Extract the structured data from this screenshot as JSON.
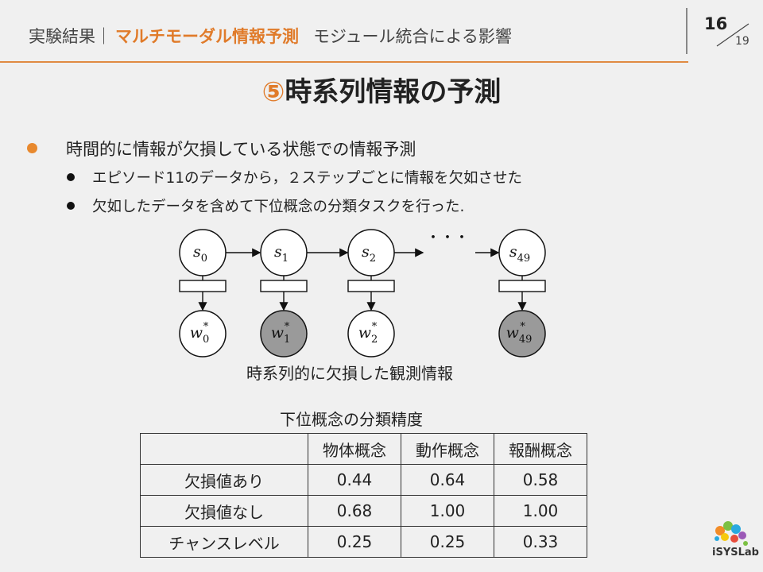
{
  "header": {
    "prefix": "実験結果｜",
    "accent": "マルチモーダル情報予測",
    "subtitle": "モジュール統合による影響",
    "page": "16",
    "total": "19"
  },
  "main_title": {
    "num": "⑤",
    "text": "時系列情報の予測"
  },
  "bullets": {
    "level1": "時間的に情報が欠損している状態での情報予測",
    "level2": [
      "エピソード11のデータから，２ステップごとに情報を欠如させた",
      "欠如したデータを含めて下位概念の分類タスクを行った."
    ]
  },
  "diagram": {
    "states": [
      {
        "base": "s",
        "sub": "0"
      },
      {
        "base": "s",
        "sub": "1"
      },
      {
        "base": "s",
        "sub": "2"
      },
      {
        "base": "s",
        "sub": "49"
      }
    ],
    "observations": [
      {
        "base": "w",
        "sub": "0",
        "sup": "*",
        "missing": false
      },
      {
        "base": "w",
        "sub": "1",
        "sup": "*",
        "missing": true
      },
      {
        "base": "w",
        "sub": "2",
        "sup": "*",
        "missing": false
      },
      {
        "base": "w",
        "sub": "49",
        "sup": "*",
        "missing": true
      }
    ],
    "ellipsis": "・・・",
    "caption": "時系列的に欠損した観測情報",
    "colors": {
      "missing_fill": "#9a9a9a",
      "normal_fill": "#ffffff"
    }
  },
  "table": {
    "title": "下位概念の分類精度",
    "columns": [
      "",
      "物体概念",
      "動作概念",
      "報酬概念"
    ],
    "rows": [
      {
        "label": "欠損値あり",
        "values": [
          "0.44",
          "0.64",
          "0.58"
        ]
      },
      {
        "label": "欠損値なし",
        "values": [
          "0.68",
          "1.00",
          "1.00"
        ]
      },
      {
        "label": "チャンスレベル",
        "values": [
          "0.25",
          "0.25",
          "0.33"
        ]
      }
    ]
  },
  "logo": {
    "text": "iSYSLab"
  },
  "colors": {
    "accent": "#e07b2a",
    "background": "#f0f0f0"
  }
}
